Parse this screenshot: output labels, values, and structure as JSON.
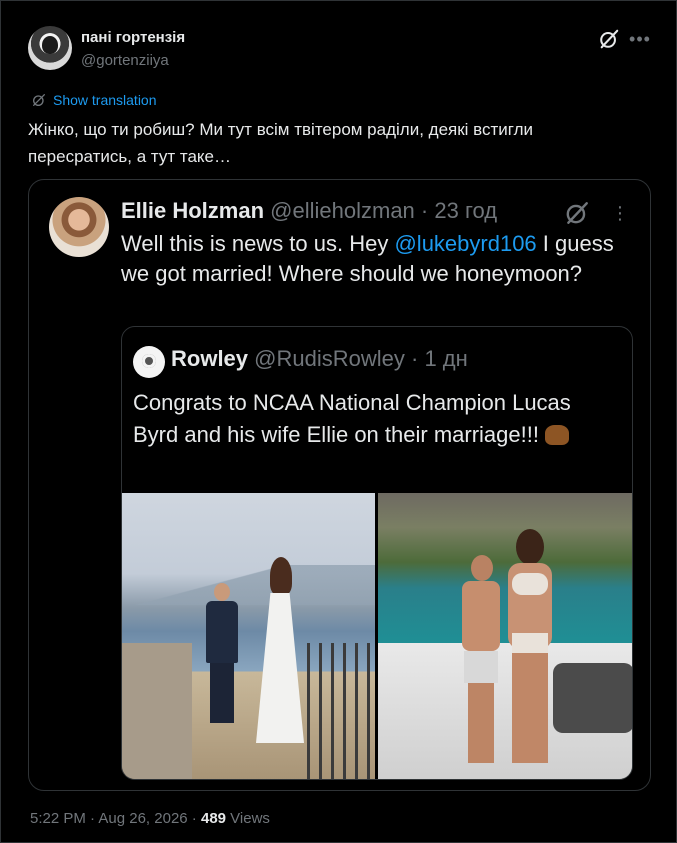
{
  "tweet": {
    "author_name": "пані гортензія",
    "author_handle": "@gortenziiya",
    "translate_label": "Show translation",
    "text": "Жінко, що ти робиш? Ми тут всім твітером раділи, деякі встигли пересратись, а тут таке…",
    "footer": {
      "time": "5:22 PM",
      "sep1": " · ",
      "date": "Aug 26, 2026",
      "sep2": " · ",
      "views_count": "489",
      "views_label": " Views"
    }
  },
  "quote1": {
    "name": "Ellie Holzman",
    "handle": "@ellieholzman",
    "sep": " · ",
    "time": "23 год",
    "text_before": "Well this is news to us. Hey ",
    "mention": "@lukebyrd106",
    "text_after": " I guess we got married! Where should we honeymoon?"
  },
  "quote2": {
    "name": "Rowley",
    "handle": "@RudisRowley",
    "sep": " · ",
    "time": "1 дн",
    "text": "Congrats to NCAA National Champion Lucas Byrd and his wife Ellie on their marriage!!! "
  },
  "icons": {
    "grok": "grok-icon",
    "more": "more-icon",
    "translate": "translate-icon",
    "clap": "clapping-hands-icon"
  },
  "colors": {
    "background": "#000000",
    "text": "#e7e9ea",
    "muted": "#71767b",
    "accent": "#1d9bf0",
    "border": "#2f3336"
  }
}
